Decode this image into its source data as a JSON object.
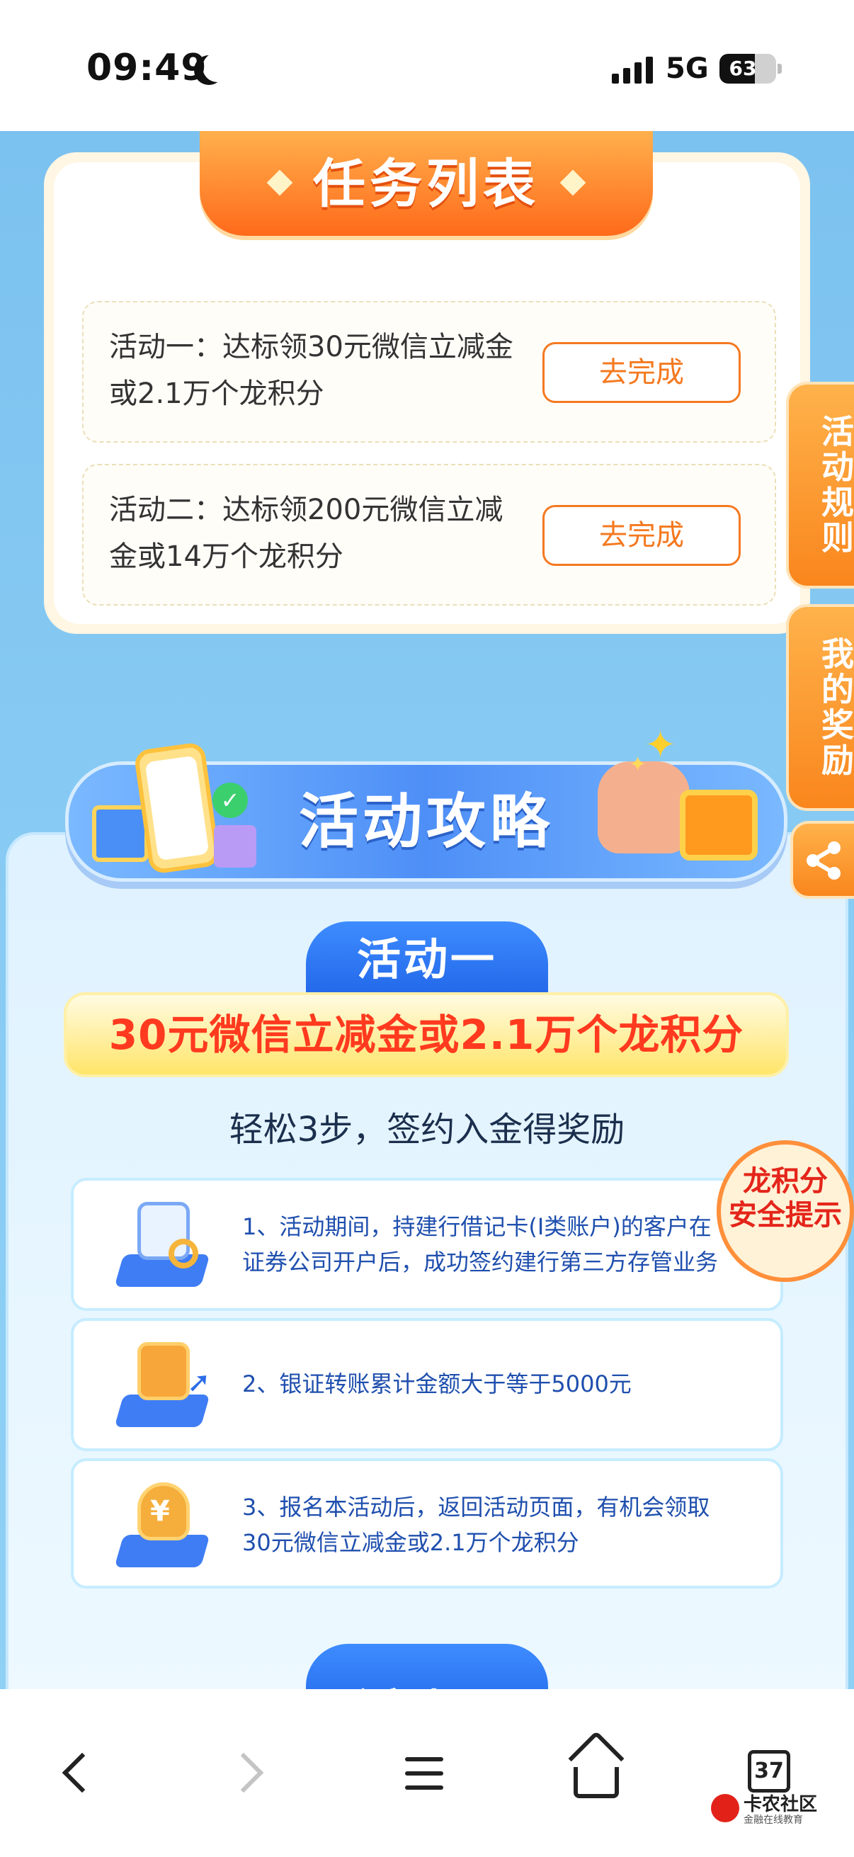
{
  "status_bar": {
    "time": "09:49",
    "network": "5G",
    "battery": "63",
    "battery_level": 0.63
  },
  "task_list": {
    "title": "任务列表",
    "tasks": [
      {
        "desc": "活动一：达标领30元微信立减金或2.1万个龙积分",
        "button": "去完成"
      },
      {
        "desc": "活动二：达标领200元微信立减金或14万个龙积分",
        "button": "去完成"
      }
    ]
  },
  "side_tabs": {
    "rules": "活动规则",
    "rewards": "我的奖励",
    "share_icon": "share-icon"
  },
  "strategy": {
    "banner_title": "活动攻略",
    "activity_one_label": "活动一",
    "headline": "30元微信立减金或2.1万个龙积分",
    "subtitle": "轻松3步，签约入金得奖励",
    "steps": [
      {
        "icon": "document-search-icon",
        "text": "1、活动期间，持建行借记卡(I类账户)的客户在证券公司开户后，成功签约建行第三方存管业务"
      },
      {
        "icon": "calculator-chart-icon",
        "text": "2、银证转账累计金额大于等于5000元"
      },
      {
        "icon": "money-bag-icon",
        "text": "3、报名本活动后，返回活动页面，有机会领取30元微信立减金或2.1万个龙积分"
      }
    ],
    "safety_badge": {
      "line1": "龙积分",
      "line2": "安全提示"
    },
    "activity_two_label": "活动二"
  },
  "bottom_nav": {
    "back_icon": "back-arrow-icon",
    "forward_icon": "forward-arrow-icon",
    "menu_icon": "menu-icon",
    "home_icon": "home-icon",
    "tabs_count": "37",
    "watermark_name": "卡农社区",
    "watermark_sub": "金融在线教育"
  },
  "colors": {
    "accent_orange": "#f47920",
    "brand_blue": "#1f63e6",
    "headline_red": "#ff3a1f",
    "page_blue": "#86caf3"
  }
}
